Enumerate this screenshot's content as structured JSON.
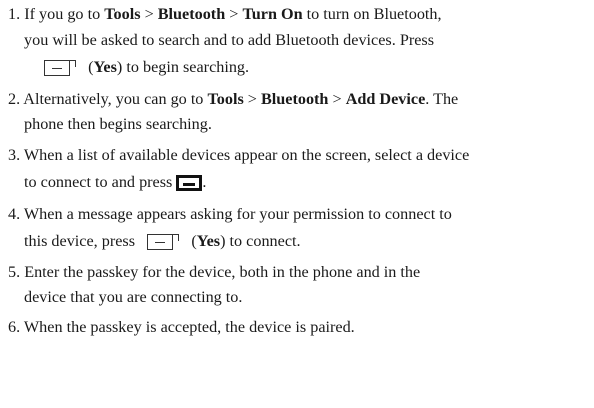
{
  "steps": [
    {
      "num": "1.",
      "a": "If you go to ",
      "t1": "Tools",
      "s1": " > ",
      "t2": "Bluetooth",
      "s2": " > ",
      "t3": "Turn On",
      "b": " to turn on Bluetooth,",
      "line2": "you will be asked to search and to add Bluetooth devices. Press",
      "yes_open": "(",
      "yes": "Yes",
      "yes_close": ") to begin searching."
    },
    {
      "num": "2.",
      "a": "Alternatively, you can go to ",
      "t1": "Tools",
      "s1": " > ",
      "t2": "Bluetooth",
      "s2": " > ",
      "t3": "Add Device",
      "b": ". The",
      "line2": "phone then begins searching."
    },
    {
      "num": "3.",
      "line1": "When a list of available devices appear on the screen, select a device",
      "line2": "to connect to and press ",
      "end": "."
    },
    {
      "num": "4.",
      "line1": "When a message appears asking for your permission to connect to",
      "line2": "this device, press ",
      "yes_open": "(",
      "yes": "Yes",
      "yes_close": ") to connect."
    },
    {
      "num": "5.",
      "line1": "Enter the passkey for the device, both in the phone and in the",
      "line2": "device that you are connecting to."
    },
    {
      "num": "6.",
      "line1": "When the passkey is accepted, the device is paired."
    }
  ],
  "icons": {
    "soft_key": "left-soft-key-icon",
    "center_key": "center-select-key-icon"
  }
}
